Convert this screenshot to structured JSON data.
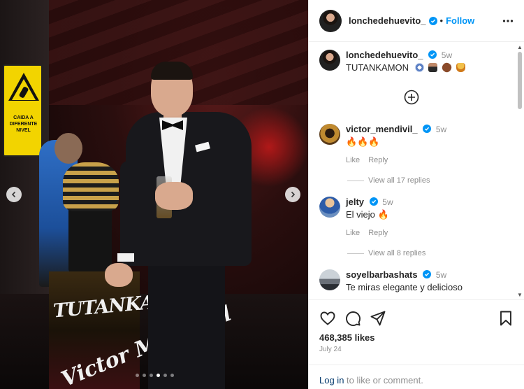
{
  "photo": {
    "sign_text": "CAIDA A DIFERENTE NIVEL",
    "statue_text": "TUTANKAMON",
    "signature_text": "Victor Mendivil",
    "carousel": {
      "total_slides": 6,
      "active_index": 3
    }
  },
  "header": {
    "username": "lonchedehuevito_",
    "separator": "•",
    "follow_label": "Follow"
  },
  "caption": {
    "username": "lonchedehuevito_",
    "time": "5w",
    "text": "TUTANKAMON"
  },
  "comments": [
    {
      "username": "victor_mendivil_",
      "time": "5w",
      "text": "🔥🔥🔥",
      "like_label": "Like",
      "reply_label": "Reply",
      "view_replies": "View all 17 replies"
    },
    {
      "username": "jelty",
      "time": "5w",
      "text": "El viejo 🔥",
      "like_label": "Like",
      "reply_label": "Reply",
      "view_replies": "View all 8 replies"
    },
    {
      "username": "soyelbarbashats",
      "time": "5w",
      "text": "Te miras elegante y delicioso"
    }
  ],
  "footer": {
    "likes": "468,385 likes",
    "date": "July 24",
    "login_link": "Log in",
    "login_rest": " to like or comment."
  },
  "colors": {
    "accent": "#0095f6",
    "link": "#00376b",
    "muted": "#8e8e8e"
  },
  "icons": [
    "verified-badge-icon",
    "more-options-icon",
    "add-circle-icon",
    "heart-icon",
    "comment-icon",
    "share-icon",
    "bookmark-icon",
    "chevron-left-icon",
    "chevron-right-icon"
  ]
}
